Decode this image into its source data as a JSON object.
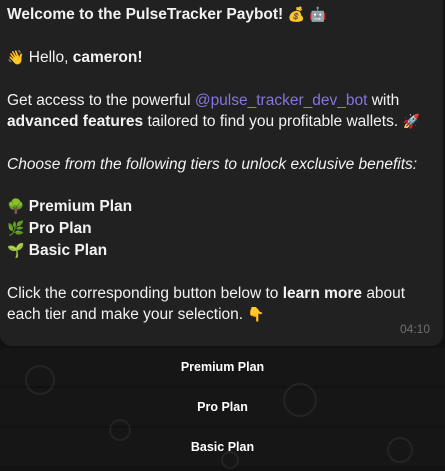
{
  "message": {
    "title": "Welcome to the PulseTracker Paybot!",
    "title_emojis": "💰 🤖",
    "greeting_emoji": "👋",
    "greeting_prefix": "Hello,",
    "greeting_name": "cameron!",
    "access_text_1": "Get access to the powerful",
    "mention": "@pulse_tracker_dev_bot",
    "access_text_2": "with",
    "advanced_features": "advanced features",
    "access_text_3": "tailored to find you profitable wallets.",
    "rocket_emoji": "🚀",
    "choose_text": "Choose from the following tiers to unlock exclusive benefits:",
    "tiers": [
      {
        "emoji": "🌳",
        "label": "Premium Plan"
      },
      {
        "emoji": "🌿",
        "label": "Pro Plan"
      },
      {
        "emoji": "🌱",
        "label": "Basic Plan"
      }
    ],
    "click_text_1": "Click the corresponding button below to",
    "learn_more": "learn more",
    "click_text_2": "about each tier and make your selection.",
    "point_emoji": "👇",
    "time": "04:10"
  },
  "keyboard": {
    "premium_label": "Premium Plan",
    "pro_label": "Pro Plan",
    "basic_label": "Basic Plan"
  }
}
